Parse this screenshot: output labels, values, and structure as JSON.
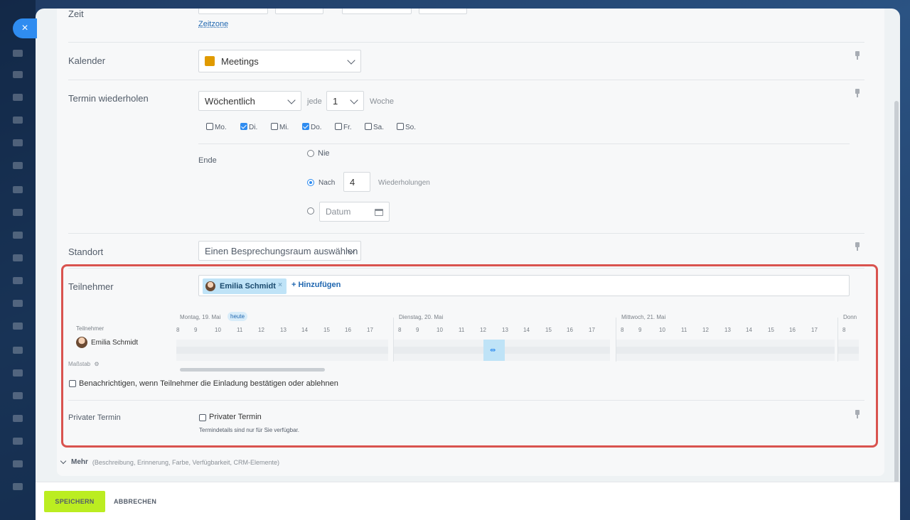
{
  "close_label": "×",
  "time": {
    "label": "Zeit",
    "timezone_link": "Zeitzone"
  },
  "calendar": {
    "label": "Kalender",
    "value": "Meetings",
    "color": "#e09a00"
  },
  "repeat": {
    "label": "Termin wiederholen",
    "frequency": "Wöchentlich",
    "every_label": "jede",
    "interval": "1",
    "unit": "Woche",
    "days": [
      {
        "label": "Mo.",
        "checked": false
      },
      {
        "label": "Di.",
        "checked": true
      },
      {
        "label": "Mi.",
        "checked": false
      },
      {
        "label": "Do.",
        "checked": true
      },
      {
        "label": "Fr.",
        "checked": false
      },
      {
        "label": "Sa.",
        "checked": false
      },
      {
        "label": "So.",
        "checked": false
      }
    ],
    "end_label": "Ende",
    "end_never": "Nie",
    "end_after": "Nach",
    "end_after_count": "4",
    "end_after_unit": "Wiederholungen",
    "end_date_placeholder": "Datum"
  },
  "location": {
    "label": "Standort",
    "value": "Einen Besprechungsraum auswählen"
  },
  "participants": {
    "label": "Teilnehmer",
    "chip_name": "Emilia Schmidt",
    "chip_remove": "×",
    "add_label": "+ Hinzufügen",
    "timeline_label": "Teilnehmer",
    "person": "Emilia Schmidt",
    "scale_label": "Maßstab",
    "today_badge": "heute",
    "days": [
      {
        "label": "Montag, 19. Mai",
        "hours": [
          "8",
          "9",
          "10",
          "11",
          "12",
          "13",
          "14",
          "15",
          "16",
          "17"
        ]
      },
      {
        "label": "Dienstag, 20. Mai",
        "hours": [
          "8",
          "9",
          "10",
          "11",
          "12",
          "13",
          "14",
          "15",
          "16",
          "17"
        ]
      },
      {
        "label": "Mittwoch, 21. Mai",
        "hours": [
          "8",
          "9",
          "10",
          "11",
          "12",
          "13",
          "14",
          "15",
          "16",
          "17"
        ]
      },
      {
        "label": "Donn",
        "hours": [
          "8"
        ]
      }
    ],
    "notify_label": "Benachrichtigen, wenn Teilnehmer die Einladung bestätigen oder ablehnen"
  },
  "private": {
    "label": "Privater Termin",
    "checkbox_label": "Privater Termin",
    "hint": "Termindetails sind nur für Sie verfügbar."
  },
  "more": {
    "label": "Mehr",
    "details": "(Beschreibung, Erinnerung, Farbe, Verfügbarkeit, CRM-Elemente)"
  },
  "footer": {
    "save": "SPEICHERN",
    "cancel": "ABBRECHEN"
  }
}
